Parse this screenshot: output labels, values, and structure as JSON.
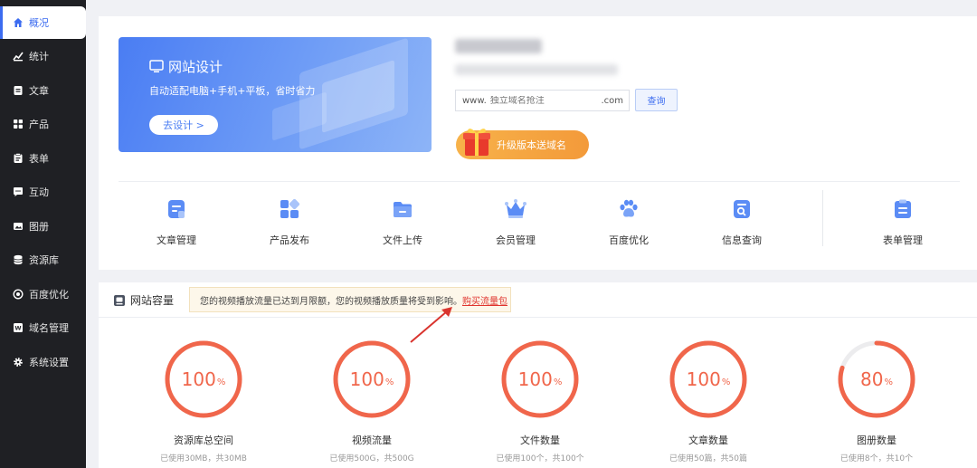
{
  "sidebar": {
    "items": [
      {
        "label": "概况",
        "icon": "home-icon",
        "active": true
      },
      {
        "label": "统计",
        "icon": "stats-icon"
      },
      {
        "label": "文章",
        "icon": "article-icon"
      },
      {
        "label": "产品",
        "icon": "grid-icon"
      },
      {
        "label": "表单",
        "icon": "form-icon"
      },
      {
        "label": "互动",
        "icon": "chat-icon"
      },
      {
        "label": "图册",
        "icon": "album-icon"
      },
      {
        "label": "资源库",
        "icon": "database-icon"
      },
      {
        "label": "百度优化",
        "icon": "seo-icon"
      },
      {
        "label": "域名管理",
        "icon": "domain-icon"
      },
      {
        "label": "系统设置",
        "icon": "gear-icon"
      }
    ]
  },
  "banner": {
    "title": "网站设计",
    "subtitle": "自动适配电脑+手机+平板，省时省力",
    "button": "去设计 >"
  },
  "domain": {
    "prefix": "www.",
    "placeholder": "独立域名抢注",
    "suffix": ".com",
    "query_button": "查询"
  },
  "promo": {
    "label": "升级版本送域名"
  },
  "quick_actions": [
    {
      "label": "文章管理",
      "icon": "article-manage-icon"
    },
    {
      "label": "产品发布",
      "icon": "product-publish-icon"
    },
    {
      "label": "文件上传",
      "icon": "file-upload-icon"
    },
    {
      "label": "会员管理",
      "icon": "crown-icon"
    },
    {
      "label": "百度优化",
      "icon": "paw-icon"
    },
    {
      "label": "信息查询",
      "icon": "search-doc-icon"
    },
    {
      "label": "表单管理",
      "icon": "clipboard-icon"
    }
  ],
  "capacity": {
    "title": "网站容量",
    "notice_text": "您的视频播放流量已达到月限额，您的视频播放质量将受到影响。",
    "notice_link": "购买流量包",
    "gauges": [
      {
        "value": "100",
        "unit": "%",
        "percent": 100,
        "label": "资源库总空间",
        "detail": "已使用30MB，共30MB"
      },
      {
        "value": "100",
        "unit": "%",
        "percent": 100,
        "label": "视频流量",
        "detail": "已使用500G，共500G"
      },
      {
        "value": "100",
        "unit": "%",
        "percent": 100,
        "label": "文件数量",
        "detail": "已使用100个，共100个"
      },
      {
        "value": "100",
        "unit": "%",
        "percent": 100,
        "label": "文章数量",
        "detail": "已使用50篇，共50篇"
      },
      {
        "value": "80",
        "unit": "%",
        "percent": 80,
        "label": "图册数量",
        "detail": "已使用8个，共10个"
      }
    ]
  },
  "colors": {
    "accent": "#3c6cf0",
    "gauge": "#f0664b",
    "sidebar": "#1f2024"
  }
}
